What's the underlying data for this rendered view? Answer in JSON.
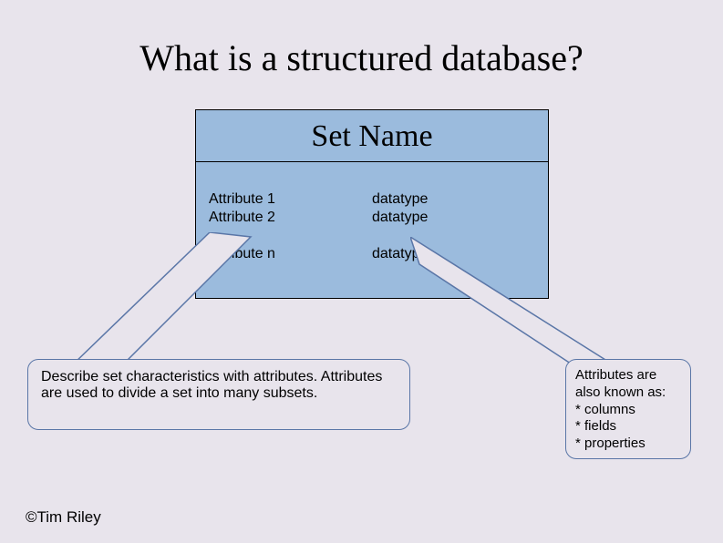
{
  "title": "What is a structured database?",
  "set": {
    "name": "Set Name",
    "rows": [
      {
        "attr": "Attribute 1",
        "type": "datatype"
      },
      {
        "attr": "Attribute 2",
        "type": "datatype"
      }
    ],
    "ellipsis": "…",
    "lastRow": {
      "attr": "Attribute n",
      "type": "datatype"
    }
  },
  "callouts": {
    "left": "Describe set characteristics with attributes. Attributes are used to divide a set into many subsets.",
    "right": {
      "intro": "Attributes are also known as:",
      "items": [
        "columns",
        "fields",
        "properties"
      ]
    }
  },
  "footer": "©Tim Riley"
}
